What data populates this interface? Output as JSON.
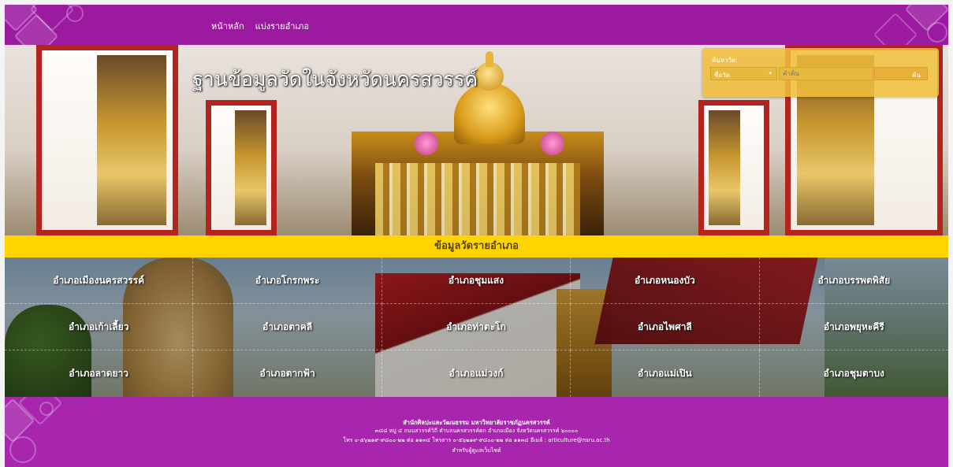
{
  "nav": {
    "home": "หน้าหลัก",
    "by_district": "แบ่งรายอำเภอ"
  },
  "hero": {
    "title": "ฐานข้อมูลวัดในจังหวัดนครสวรรค์"
  },
  "search": {
    "label": "ค้นหาวัด:",
    "select_value": "ชื่อวัด",
    "input_placeholder": "คำค้น",
    "button": "ค้น"
  },
  "section": {
    "title": "ข้อมูลวัดรายอำเภอ"
  },
  "districts": [
    "อำเภอเมืองนครสวรรค์",
    "อำเภอโกรกพระ",
    "อำเภอชุมแสง",
    "อำเภอหนองบัว",
    "อำเภอบรรพตพิสัย",
    "อำเภอเก้าเลี้ยว",
    "อำเภอตาคลี",
    "อำเภอท่าตะโก",
    "อำเภอไพศาลี",
    "อำเภอพยุหะคีรี",
    "อำเภอลาดยาว",
    "อำเภอตากฟ้า",
    "อำเภอแม่วงก์",
    "อำเภอแม่เปิน",
    "อำเภอชุมตาบง"
  ],
  "footer": {
    "org": "สำนักศิลปะและวัฒนธรรม มหาวิทยาลัยราชภัฏนครสวรรค์",
    "address": "๓๘๘ หมู่ ๔ ถนนสวรรค์วิถี ตำบลนครสวรรค์ตก อำเภอเมือง จังหวัดนครสวรรค์ ๖๐๐๐๐",
    "contact": "โทร ๐-๕๖๒๑๙-๙๘๐๐-๒๒ ต่อ ๑๑๓๔ โทรสาร ๐-๕๖๒๑๙-๙๘๐๐-๒๒ ต่อ ๑๑๓๔ อีเมล์ : articulture@nsru.ac.th",
    "admin_link": "สำหรับผู้ดูแลเว็บไซต์"
  },
  "colors": {
    "topbar": "#9b1aa0",
    "footer": "#a726ad",
    "band": "#ffd400",
    "search_box": "#f0be3c"
  }
}
